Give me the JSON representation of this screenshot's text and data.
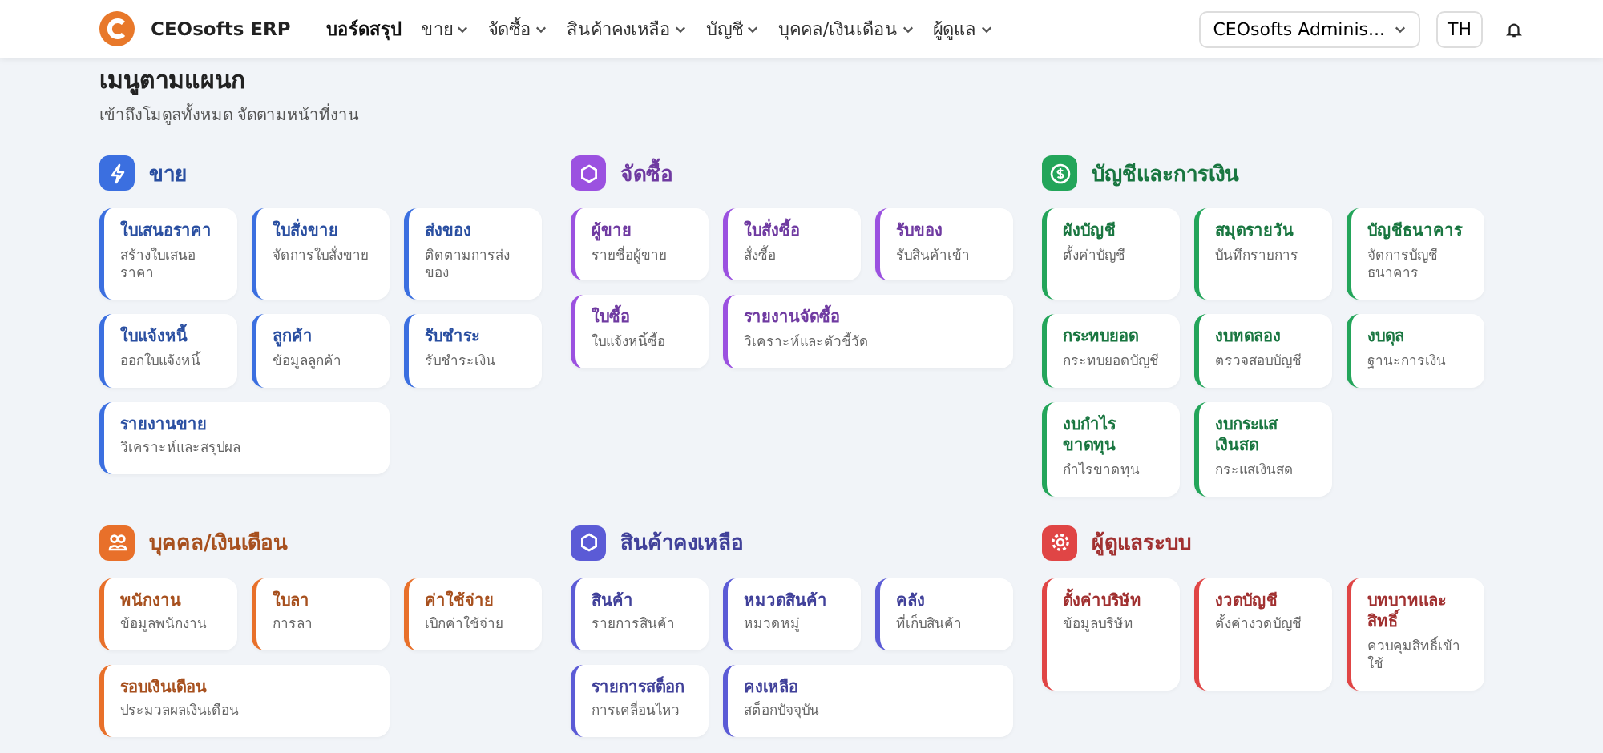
{
  "brand": {
    "name": "CEOsofts ERP"
  },
  "nav": [
    {
      "label": "บอร์ดสรุป",
      "dropdown": false,
      "selected": true
    },
    {
      "label": "ขาย",
      "dropdown": true,
      "selected": false
    },
    {
      "label": "จัดซื้อ",
      "dropdown": true,
      "selected": false
    },
    {
      "label": "สินค้าคงเหลือ",
      "dropdown": true,
      "selected": false
    },
    {
      "label": "บัญชี",
      "dropdown": true,
      "selected": false
    },
    {
      "label": "บุคคล/เงินเดือน",
      "dropdown": true,
      "selected": false
    },
    {
      "label": "ผู้ดูแล",
      "dropdown": true,
      "selected": false
    }
  ],
  "user_menu": {
    "label": "CEOsofts Adminis..."
  },
  "language": "TH",
  "page": {
    "title": "เมนูตามแผนก",
    "subtitle": "เข้าถึงโมดูลทั้งหมด จัดตามหน้าที่งาน"
  },
  "sections": [
    {
      "title": "ขาย",
      "color": "#3b6fe0",
      "items": [
        {
          "title": "ใบเสนอราคา",
          "desc": "สร้างใบเสนอราคา",
          "kind": "normal"
        },
        {
          "title": "ใบสั่งขาย",
          "desc": "จัดการใบสั่งขาย",
          "kind": "normal"
        },
        {
          "title": "ส่งของ",
          "desc": "ติดตามการส่งของ",
          "kind": "normal"
        },
        {
          "title": "ใบแจ้งหนี้",
          "desc": "ออกใบแจ้งหนี้",
          "kind": "normal"
        },
        {
          "title": "ลูกค้า",
          "desc": "ข้อมูลลูกค้า",
          "kind": "normal"
        },
        {
          "title": "รับชำระ",
          "desc": "รับชำระเงิน",
          "kind": "normal"
        },
        {
          "title": "รายงานขาย",
          "desc": "วิเคราะห์และสรุปผล",
          "kind": "wide"
        }
      ]
    },
    {
      "title": "จัดซื้อ",
      "color": "#9b51e0",
      "items": [
        {
          "title": "ผู้ขาย",
          "desc": "รายชื่อผู้ขาย",
          "kind": "normal"
        },
        {
          "title": "ใบสั่งซื้อ",
          "desc": "สั่งซื้อ",
          "kind": "normal"
        },
        {
          "title": "รับของ",
          "desc": "รับสินค้าเข้า",
          "kind": "normal"
        },
        {
          "title": "ใบซื้อ",
          "desc": "ใบแจ้งหนี้ซื้อ",
          "kind": "normal"
        },
        {
          "title": "รายงานจัดซื้อ",
          "desc": "วิเคราะห์และตัวชี้วัด",
          "kind": "wide"
        }
      ]
    },
    {
      "title": "บัญชีและการเงิน",
      "color": "#23a55a",
      "items": [
        {
          "title": "ผังบัญชี",
          "desc": "ตั้งค่าบัญชี",
          "kind": "normal"
        },
        {
          "title": "สมุดรายวัน",
          "desc": "บันทึกรายการ",
          "kind": "normal"
        },
        {
          "title": "บัญชีธนาคาร",
          "desc": "จัดการบัญชีธนาคาร",
          "kind": "normal"
        },
        {
          "title": "กระทบยอด",
          "desc": "กระทบยอดบัญชี",
          "kind": "normal"
        },
        {
          "title": "งบทดลอง",
          "desc": "ตรวจสอบบัญชี",
          "kind": "normal"
        },
        {
          "title": "งบดุล",
          "desc": "ฐานะการเงิน",
          "kind": "normal"
        },
        {
          "title": "งบกำไรขาดทุน",
          "desc": "กำไรขาดทุน",
          "kind": "normal"
        },
        {
          "title": "งบกระแสเงินสด",
          "desc": "กระแสเงินสด",
          "kind": "normal"
        }
      ]
    },
    {
      "title": "บุคคล/เงินเดือน",
      "color": "#e8702a",
      "items": [
        {
          "title": "พนักงาน",
          "desc": "ข้อมูลพนักงาน",
          "kind": "normal"
        },
        {
          "title": "ใบลา",
          "desc": "การลา",
          "kind": "normal"
        },
        {
          "title": "ค่าใช้จ่าย",
          "desc": "เบิกค่าใช้จ่าย",
          "kind": "normal"
        },
        {
          "title": "รอบเงินเดือน",
          "desc": "ประมวลผลเงินเดือน",
          "kind": "wide"
        }
      ]
    },
    {
      "title": "สินค้าคงเหลือ",
      "color": "#5b5bd6",
      "items": [
        {
          "title": "สินค้า",
          "desc": "รายการสินค้า",
          "kind": "normal"
        },
        {
          "title": "หมวดสินค้า",
          "desc": "หมวดหมู่",
          "kind": "normal"
        },
        {
          "title": "คลัง",
          "desc": "ที่เก็บสินค้า",
          "kind": "normal"
        },
        {
          "title": "รายการสต็อก",
          "desc": "การเคลื่อนไหว",
          "kind": "normal"
        },
        {
          "title": "คงเหลือ",
          "desc": "สต็อกปัจจุบัน",
          "kind": "wide"
        }
      ]
    },
    {
      "title": "ผู้ดูแลระบบ",
      "color": "#e04545",
      "items": [
        {
          "title": "ตั้งค่าบริษัท",
          "desc": "ข้อมูลบริษัท",
          "kind": "normal"
        },
        {
          "title": "งวดบัญชี",
          "desc": "ตั้งค่างวดบัญชี",
          "kind": "normal"
        },
        {
          "title": "บทบาทและสิทธิ์",
          "desc": "ควบคุมสิทธิ์เข้าใช้",
          "kind": "normal"
        }
      ]
    }
  ]
}
